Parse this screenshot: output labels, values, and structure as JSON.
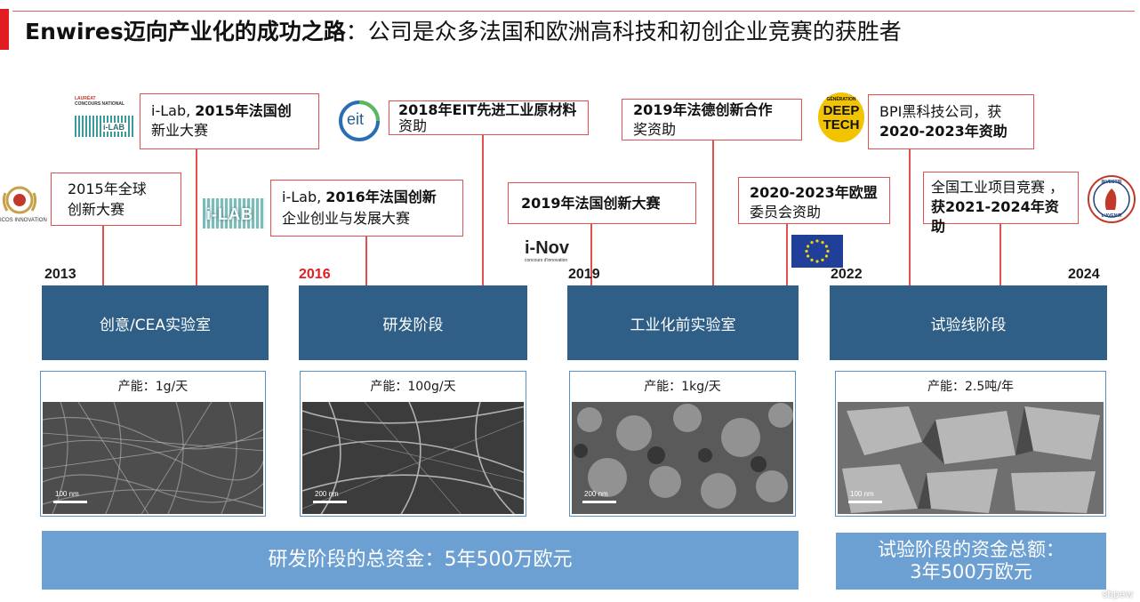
{
  "title": {
    "bold_part": "Enwires迈向产业化的成功之路",
    "rest": "：公司是众多法国和欧洲高科技和初创企业竞赛的获胜者"
  },
  "callouts": {
    "c1": {
      "line1": "2015年全球",
      "line2": "创新大赛"
    },
    "c2": {
      "pre": "i-Lab, ",
      "bold": "2015年法国创",
      "line2": "新业大赛"
    },
    "c3": {
      "pre": "i-Lab, ",
      "bold": "2016年法国创新",
      "line2": "企业创业与发展大赛"
    },
    "c4": {
      "line1": "2018年EIT先进工业原材料",
      "line2": "资助"
    },
    "c5": {
      "line1": "2019年法国创新大赛"
    },
    "c6": {
      "line1": "2019年法德创新合作",
      "line2": "奖资助"
    },
    "c7": {
      "line1": "2020-2023年欧盟",
      "line2": "委员会资助"
    },
    "c8": {
      "line1": "BPI黑科技公司，获",
      "line2": "2020-2023年资助"
    },
    "c9": {
      "line1": "全国工业项目竞赛 ，",
      "line2": "获2021-2024年资助"
    }
  },
  "years": {
    "y2013": "2013",
    "y2016": "2016",
    "y2019": "2019",
    "y2022": "2022",
    "y2024": "2024"
  },
  "phases": [
    "创意/CEA实验室",
    "研发阶段",
    "工业化前实验室",
    "试验线阶段"
  ],
  "capacities": [
    "产能：1g/天",
    "产能：100g/天",
    "产能：1kg/天",
    "产能：2.5吨/年"
  ],
  "scales": [
    "100 nm",
    "200 nm",
    "200 nm",
    "100 nm"
  ],
  "funding": {
    "rd": "研发阶段的总资金：5年500万欧元",
    "pilot_line1": "试验阶段的资金总额：",
    "pilot_line2": "3年500万欧元"
  },
  "logos": {
    "eit": "eit",
    "inov": "i-Nov",
    "inov_sub": "concours d'innovation",
    "deeptech_top": "GÉNÉRATION",
    "deeptech_1": "DEEP",
    "deeptech_2": "TECH",
    "ilab": "i-LAB",
    "laureat_line1": "LAURÉAT",
    "laureat_line2": "CONCOURS NATIONAL",
    "investir_top": "INVESTIR",
    "investir_bottom": "L'AVENIR",
    "worldinno": "ICOS INNOVATION"
  },
  "colors": {
    "accent_red": "#e01e22",
    "phase_blue": "#2f5f86",
    "fund_blue": "#6da0d2",
    "card_border": "#5b8fc9"
  },
  "watermark": "sbpew"
}
